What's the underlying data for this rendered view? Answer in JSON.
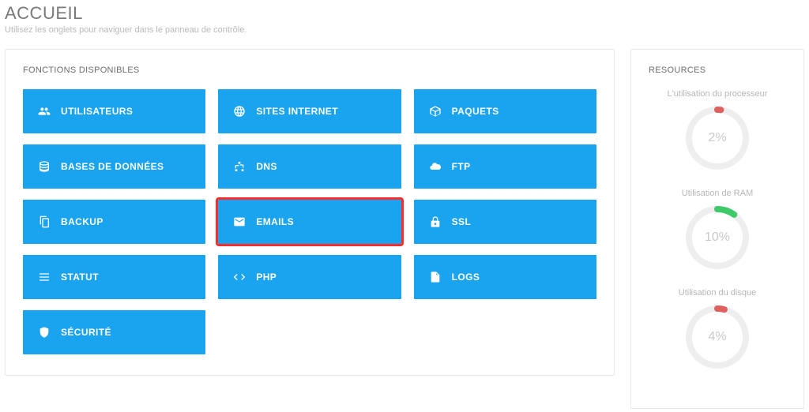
{
  "header": {
    "title": "ACCUEIL",
    "subtitle": "Utilisez les onglets pour naviguer dans le panneau de contrôle."
  },
  "functions": {
    "heading": "FONCTIONS DISPONIBLES",
    "tiles": [
      {
        "label": "UTILISATEURS",
        "icon": "users",
        "highlight": false
      },
      {
        "label": "SITES INTERNET",
        "icon": "globe",
        "highlight": false
      },
      {
        "label": "PAQUETS",
        "icon": "package",
        "highlight": false
      },
      {
        "label": "BASES DE DONNÉES",
        "icon": "database",
        "highlight": false
      },
      {
        "label": "DNS",
        "icon": "sitemap",
        "highlight": false
      },
      {
        "label": "FTP",
        "icon": "cloud",
        "highlight": false
      },
      {
        "label": "BACKUP",
        "icon": "copy",
        "highlight": false
      },
      {
        "label": "EMAILS",
        "icon": "envelope",
        "highlight": true
      },
      {
        "label": "SSL",
        "icon": "lock",
        "highlight": false
      },
      {
        "label": "STATUT",
        "icon": "bars",
        "highlight": false
      },
      {
        "label": "PHP",
        "icon": "code",
        "highlight": false
      },
      {
        "label": "LOGS",
        "icon": "file",
        "highlight": false
      },
      {
        "label": "SÉCURITÉ",
        "icon": "shield",
        "highlight": false
      }
    ]
  },
  "resources": {
    "heading": "RESOURCES",
    "items": [
      {
        "label": "L'utilisation du processeur",
        "value": 2,
        "display": "2%",
        "color": "#e06060"
      },
      {
        "label": "Utilisation de RAM",
        "value": 10,
        "display": "10%",
        "color": "#3fc96a"
      },
      {
        "label": "Utilisation du disque",
        "value": 4,
        "display": "4%",
        "color": "#e06060"
      }
    ]
  }
}
